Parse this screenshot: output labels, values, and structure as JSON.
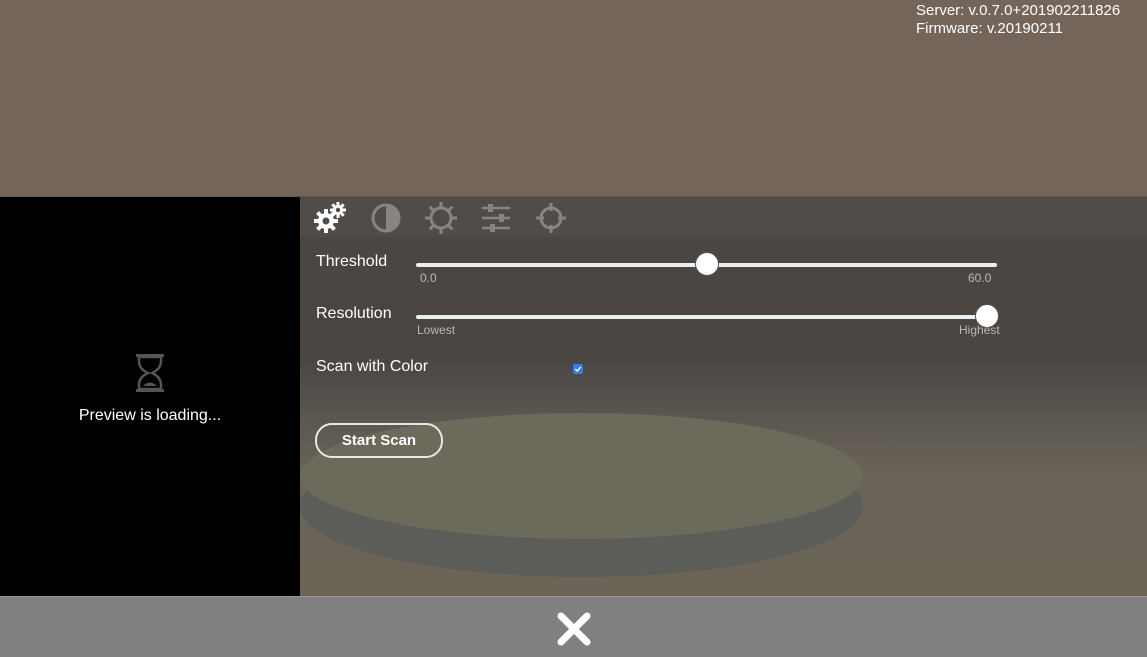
{
  "header": {
    "server_version": "Server: v.0.7.0+201902211826",
    "firmware_version": "Firmware: v.20190211"
  },
  "preview": {
    "status_text": "Preview is loading...",
    "icon": "hourglass-icon"
  },
  "tabs": [
    {
      "icon": "gears-icon",
      "active": true
    },
    {
      "icon": "contrast-icon",
      "active": false
    },
    {
      "icon": "brightness-icon",
      "active": false
    },
    {
      "icon": "sliders-icon",
      "active": false
    },
    {
      "icon": "crosshair-icon",
      "active": false
    }
  ],
  "threshold": {
    "label": "Threshold",
    "min_label": "0.0",
    "max_label": "60.0",
    "value_fraction": 0.5
  },
  "resolution": {
    "label": "Resolution",
    "min_label": "Lowest",
    "max_label": "Highest",
    "value_fraction": 1.0
  },
  "scan_color": {
    "label": "Scan with Color",
    "checked": true
  },
  "actions": {
    "start_scan": "Start Scan"
  },
  "footer": {
    "close_icon": "close-icon"
  },
  "colors": {
    "accent_checkbox": "#2f7ef5",
    "background": "#74655b",
    "footer": "#808080"
  }
}
